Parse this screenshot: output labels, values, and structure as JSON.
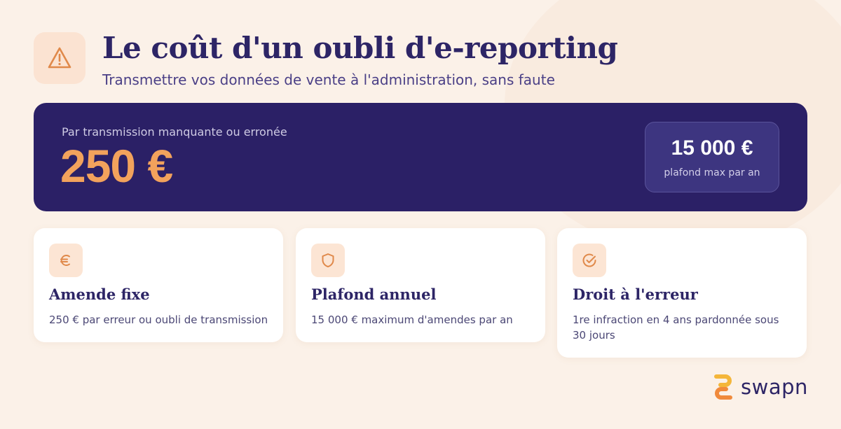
{
  "header": {
    "title": "Le coût d'un oubli d'e-reporting",
    "subtitle": "Transmettre vos données de vente à l'administration, sans faute",
    "icon": "warning-icon"
  },
  "banner": {
    "label": "Par transmission manquante ou erronée",
    "amount": "250 €",
    "cap_value": "15 000 €",
    "cap_label": "plafond max par an"
  },
  "cards": [
    {
      "icon": "euro-icon",
      "title": "Amende fixe",
      "description": "250 € par erreur ou oubli de transmission"
    },
    {
      "icon": "shield-icon",
      "title": "Plafond annuel",
      "description": "15 000 € maximum d'amendes par an"
    },
    {
      "icon": "check-circle-icon",
      "title": "Droit à l'erreur",
      "description": "1re infraction en 4 ans pardonnée sous 30 jours"
    }
  ],
  "brand": {
    "name": "swapn"
  },
  "colors": {
    "navy": "#2b2066",
    "orange": "#f2a25c",
    "background": "#fbf1e8",
    "icon_bg": "#fce5d4"
  }
}
